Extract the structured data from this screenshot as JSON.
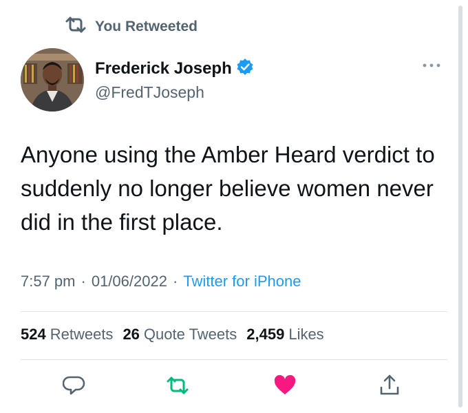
{
  "banner": {
    "text": "You Retweeted",
    "icon": "retweet-icon"
  },
  "author": {
    "display_name": "Frederick Joseph",
    "handle": "@FredTJoseph",
    "verified_icon": "verified-badge-icon"
  },
  "tweet": {
    "text": "Anyone using the Amber Heard verdict to suddenly no longer believe women never did in the first place."
  },
  "meta": {
    "time": "7:57 pm",
    "separator1": "·",
    "date": "01/06/2022",
    "separator2": "·",
    "source": "Twitter for iPhone"
  },
  "stats": {
    "retweets_count": "524",
    "retweets_label": "Retweets",
    "quotes_count": "26",
    "quotes_label": "Quote Tweets",
    "likes_count": "2,459",
    "likes_label": "Likes"
  },
  "colors": {
    "accent": "#1d9bf0",
    "retweet_green": "#00ba7c",
    "like_pink": "#f91880",
    "muted": "#536471"
  },
  "actions": {
    "reply_icon": "reply-icon",
    "retweet_icon": "retweet-icon",
    "like_icon": "heart-icon",
    "share_icon": "share-icon"
  }
}
